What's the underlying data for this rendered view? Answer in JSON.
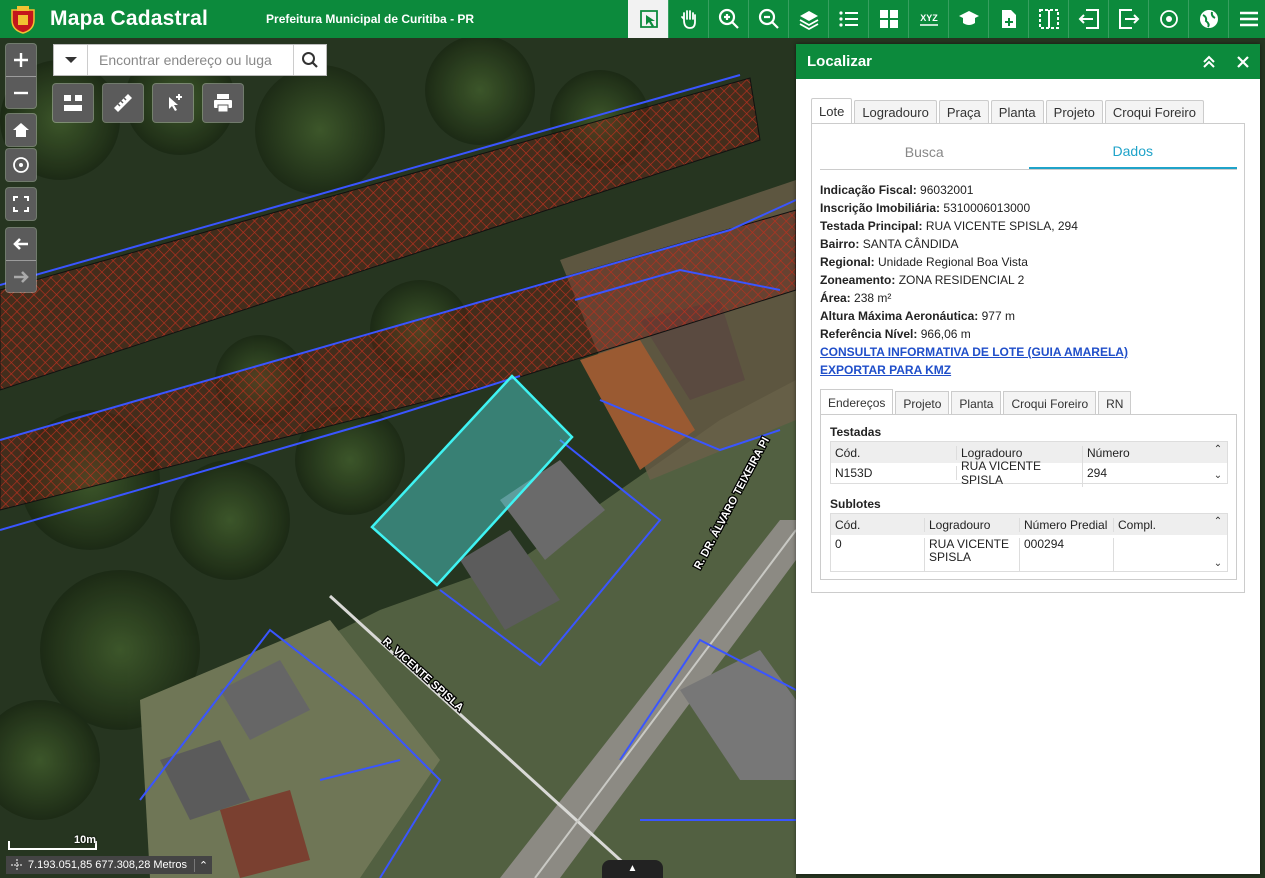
{
  "app": {
    "title": "Mapa Cadastral",
    "subtitle": "Prefeitura Municipal de Curitiba - PR",
    "accent_color": "#0c8a3c"
  },
  "toolbar": {
    "icons": [
      "identify-icon",
      "pan-hand-icon",
      "zoom-in-icon",
      "zoom-out-icon",
      "layers-add-icon",
      "legend-list-icon",
      "grid-icon",
      "xyz-coordinates-icon",
      "education-icon",
      "add-document-icon",
      "split-view-icon",
      "import-icon",
      "export-icon",
      "locate-point-icon",
      "map-globe-icon",
      "menu-icon"
    ],
    "xyz_label": "XYZ"
  },
  "search": {
    "placeholder": "Encontrar endereço ou luga"
  },
  "map_labels": {
    "street1": "R. VICENTE SPISLA",
    "street2": "R. DR. ÁLVARO TEIXEIRA PI"
  },
  "panel": {
    "title": "Localizar",
    "main_tabs": [
      "Lote",
      "Logradouro",
      "Praça",
      "Planta",
      "Projeto",
      "Croqui Foreiro"
    ],
    "active_main_tab": "Lote",
    "sub_tabs": [
      "Busca",
      "Dados"
    ],
    "active_sub_tab": "Dados",
    "fields": [
      {
        "label": "Indicação Fiscal:",
        "value": "96032001"
      },
      {
        "label": "Inscrição Imobiliária:",
        "value": "5310006013000"
      },
      {
        "label": "Testada Principal:",
        "value": "RUA VICENTE SPISLA, 294"
      },
      {
        "label": "Bairro:",
        "value": "SANTA CÂNDIDA"
      },
      {
        "label": "Regional:",
        "value": "Unidade Regional Boa Vista"
      },
      {
        "label": "Zoneamento:",
        "value": "ZONA RESIDENCIAL 2"
      },
      {
        "label": "Área:",
        "value": "238 m²"
      },
      {
        "label": "Altura Máxima Aeronáutica:",
        "value": "977 m"
      },
      {
        "label": "Referência Nível:",
        "value": "966,06 m"
      }
    ],
    "links": [
      "CONSULTA INFORMATIVA DE LOTE (GUIA AMARELA)",
      "EXPORTAR PARA KMZ"
    ],
    "inner_tabs": [
      "Endereços",
      "Projeto",
      "Planta",
      "Croqui Foreiro",
      "RN"
    ],
    "active_inner_tab": "Endereços",
    "testadas": {
      "title": "Testadas",
      "columns": [
        "Cód.",
        "Logradouro",
        "Número"
      ],
      "rows": [
        [
          "N153D",
          "RUA VICENTE SPISLA",
          "294"
        ]
      ]
    },
    "sublotes": {
      "title": "Sublotes",
      "columns": [
        "Cód.",
        "Logradouro",
        "Número Predial",
        "Compl."
      ],
      "rows": [
        [
          "0",
          "RUA VICENTE SPISLA",
          "000294",
          ""
        ]
      ]
    }
  },
  "status": {
    "coordinates": "7.193.051,85 677.308,28 Metros",
    "scale": "10m"
  }
}
